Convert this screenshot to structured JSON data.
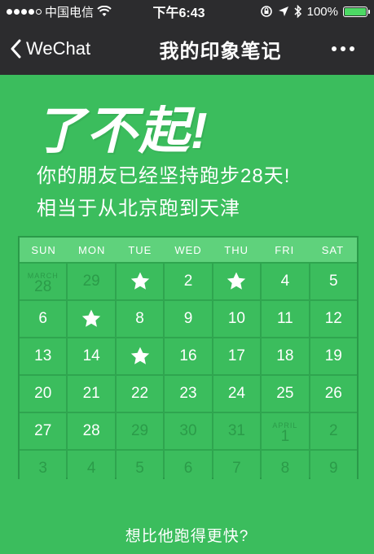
{
  "status_bar": {
    "carrier": "中国电信",
    "time": "下午6:43",
    "battery": "100%"
  },
  "nav": {
    "back_label": "WeChat",
    "title": "我的印象笔记"
  },
  "hero": {
    "title": "了不起!",
    "line1": "你的朋友已经坚持跑步28天!",
    "line2": "相当于从北京跑到天津"
  },
  "calendar": {
    "weekdays": [
      "SUN",
      "MON",
      "TUE",
      "WED",
      "THU",
      "FRI",
      "SAT"
    ],
    "cells": [
      {
        "text": "28",
        "month": "MARCH",
        "dim": true
      },
      {
        "text": "29",
        "dim": true
      },
      {
        "star": true
      },
      {
        "text": "2"
      },
      {
        "star": true
      },
      {
        "text": "4"
      },
      {
        "text": "5"
      },
      {
        "text": "6"
      },
      {
        "star": true
      },
      {
        "text": "8"
      },
      {
        "text": "9"
      },
      {
        "text": "10"
      },
      {
        "text": "11"
      },
      {
        "text": "12"
      },
      {
        "text": "13"
      },
      {
        "text": "14"
      },
      {
        "star": true
      },
      {
        "text": "16"
      },
      {
        "text": "17"
      },
      {
        "text": "18"
      },
      {
        "text": "19"
      },
      {
        "text": "20"
      },
      {
        "text": "21"
      },
      {
        "text": "22"
      },
      {
        "text": "23"
      },
      {
        "text": "24"
      },
      {
        "text": "25"
      },
      {
        "text": "26"
      },
      {
        "text": "27"
      },
      {
        "text": "28"
      },
      {
        "text": "29",
        "dim": true
      },
      {
        "text": "30",
        "dim": true
      },
      {
        "text": "31",
        "dim": true
      },
      {
        "text": "1",
        "month": "APRIL",
        "dim": true
      },
      {
        "text": "2",
        "dim": true
      },
      {
        "text": "3",
        "dim": true
      },
      {
        "text": "4",
        "dim": true
      },
      {
        "text": "5",
        "dim": true
      },
      {
        "text": "6",
        "dim": true
      },
      {
        "text": "7",
        "dim": true
      },
      {
        "text": "8",
        "dim": true
      },
      {
        "text": "9",
        "dim": true
      }
    ]
  },
  "footer": {
    "link": "想比他跑得更快?"
  }
}
